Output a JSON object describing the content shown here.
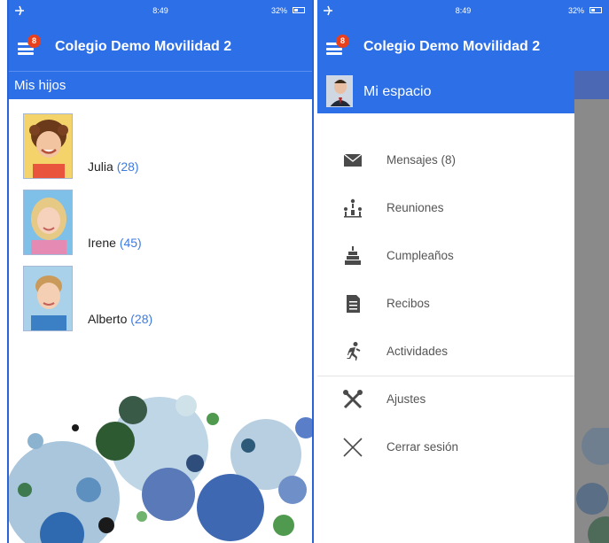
{
  "status_bar": {
    "time": "8:49",
    "battery": "32%"
  },
  "app": {
    "title": "Colegio Demo Movilidad 2",
    "notification_count": "8"
  },
  "left_screen": {
    "section_title": "Mis hijos",
    "children": [
      {
        "name": "Julia",
        "count": "(28)"
      },
      {
        "name": "Irene",
        "count": "(45)"
      },
      {
        "name": "Alberto",
        "count": "(28)"
      }
    ]
  },
  "drawer": {
    "header_label": "Mi espacio",
    "items": [
      {
        "label": "Mensajes (8)",
        "icon": "envelope-icon"
      },
      {
        "label": "Reuniones",
        "icon": "meeting-icon"
      },
      {
        "label": "Cumpleaños",
        "icon": "birthday-cake-icon"
      },
      {
        "label": "Recibos",
        "icon": "receipt-icon"
      },
      {
        "label": "Actividades",
        "icon": "running-person-icon"
      },
      {
        "label": "Ajustes",
        "icon": "tools-icon"
      },
      {
        "label": "Cerrar sesión",
        "icon": "close-icon"
      }
    ]
  },
  "colors": {
    "primary": "#2d6fe6",
    "badge": "#e8401c",
    "count_text": "#3d7be0"
  }
}
